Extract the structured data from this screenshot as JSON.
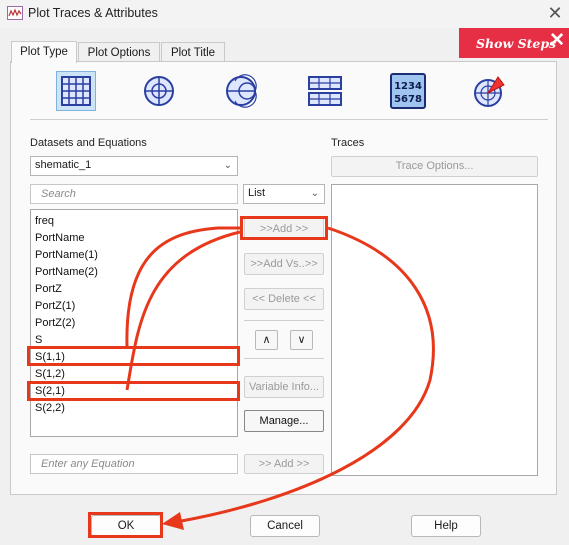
{
  "window": {
    "title": "Plot Traces & Attributes"
  },
  "tabs": [
    {
      "label": "Plot Type"
    },
    {
      "label": "Plot Options"
    },
    {
      "label": "Plot Title"
    }
  ],
  "show_steps": {
    "label": "Show Steps"
  },
  "plot_types": [
    {
      "icon": "rectangular-grid-icon",
      "selected": true
    },
    {
      "icon": "polar-grid-icon",
      "selected": false
    },
    {
      "icon": "smith-chart-icon",
      "selected": false
    },
    {
      "icon": "stacked-rectangular-grid-icon",
      "selected": false
    },
    {
      "icon": "tabular-numbers-icon",
      "text_top": "1234",
      "text_bottom": "5678",
      "selected": false
    },
    {
      "icon": "antenna-pattern-icon",
      "selected": false
    }
  ],
  "datasets": {
    "label": "Datasets and Equations",
    "selected": "shematic_1",
    "search_placeholder": "Search",
    "list_mode": "List",
    "items": [
      "freq",
      "PortName",
      "PortName(1)",
      "PortName(2)",
      "PortZ",
      "PortZ(1)",
      "PortZ(2)",
      "S",
      "S(1,1)",
      "S(1,2)",
      "S(2,1)",
      "S(2,2)"
    ],
    "equation_placeholder": "Enter any Equation",
    "equation_add": ">> Add >>"
  },
  "middle_buttons": {
    "add": ">>Add >>",
    "add_vs": ">>Add Vs..>>",
    "delete": "<< Delete <<",
    "up": "∧",
    "down": "∨",
    "variable_info": "Variable Info...",
    "manage": "Manage..."
  },
  "traces": {
    "label": "Traces",
    "options_button": "Trace Options..."
  },
  "bottom_buttons": {
    "ok": "OK",
    "cancel": "Cancel",
    "help": "Help"
  },
  "colors": {
    "highlight": "#e8381c",
    "show_steps_bg": "#e62e45",
    "icon_blue": "#2a3fa0",
    "selected_bg": "#cde4f7"
  }
}
